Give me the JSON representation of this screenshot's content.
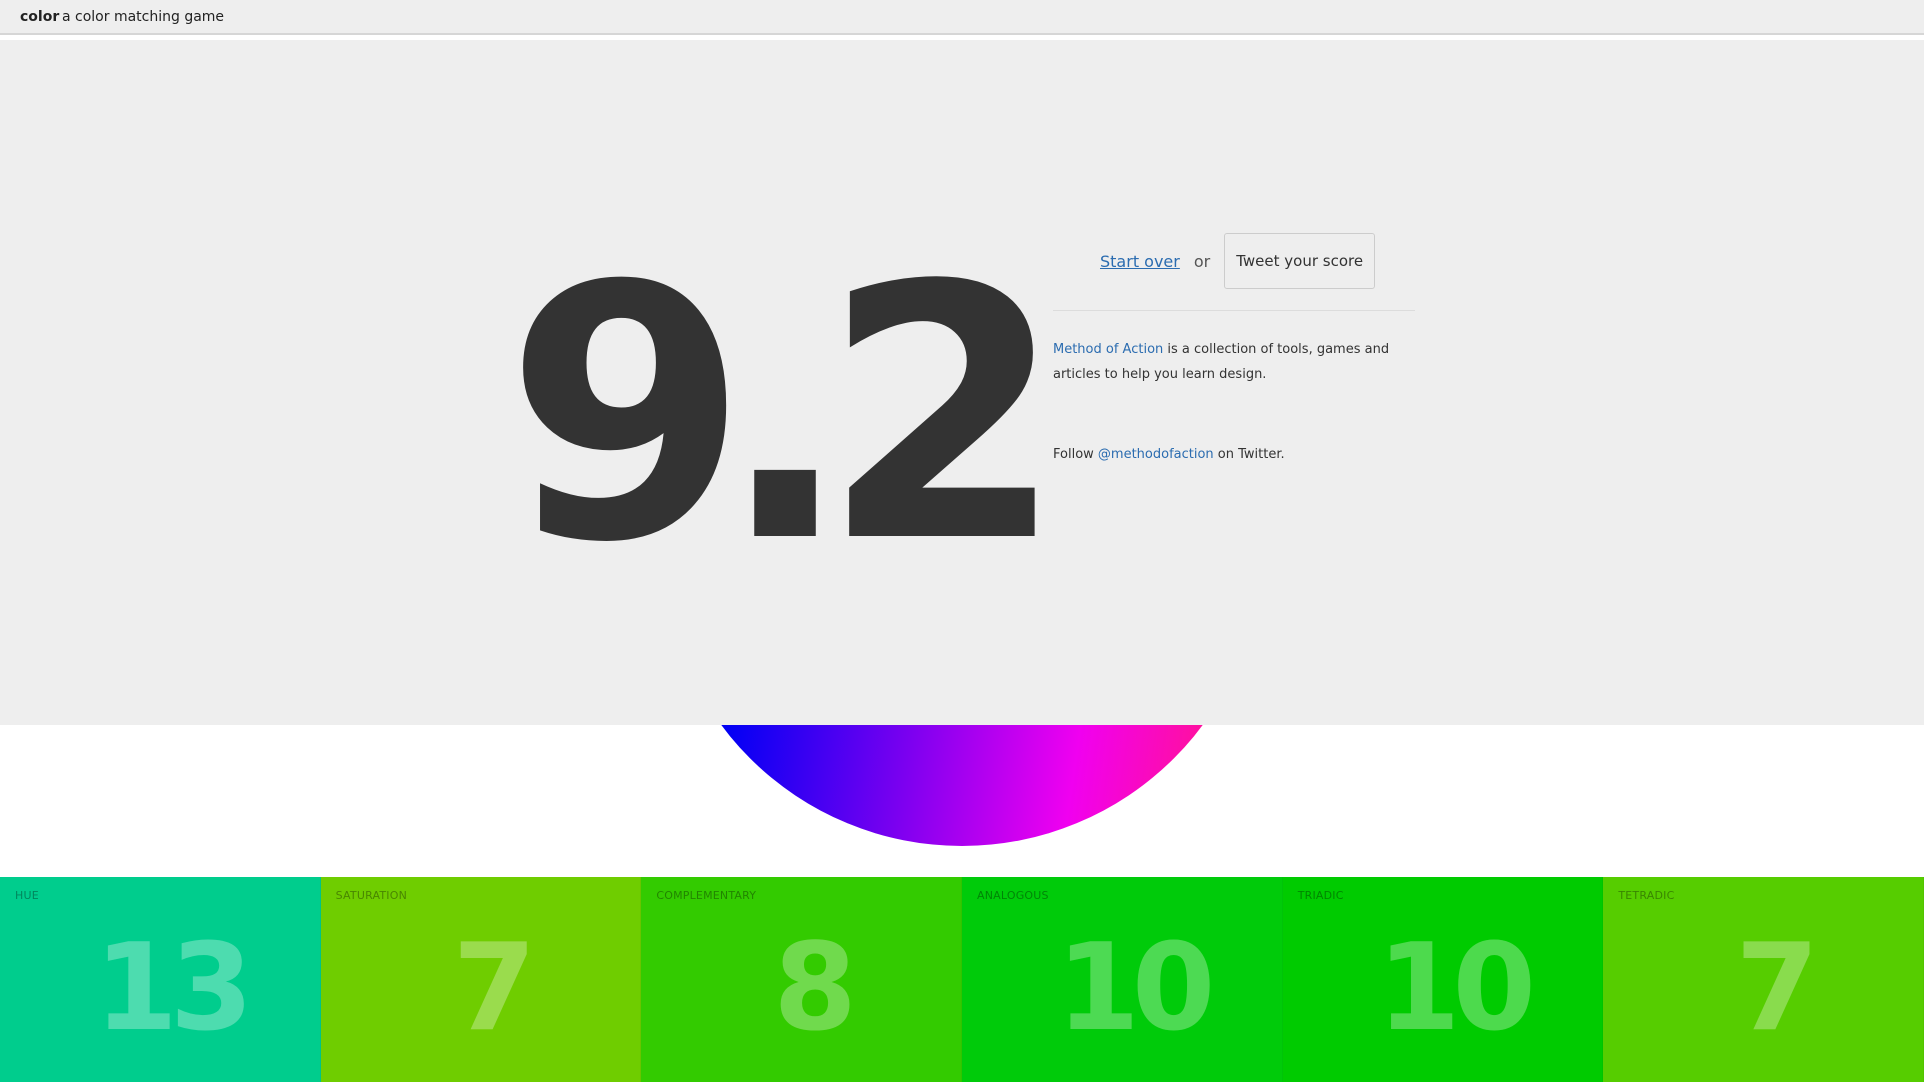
{
  "header": {
    "brand": "color",
    "tagline": "a color matching game"
  },
  "result": {
    "score": "9.2",
    "start_over_label": "Start over",
    "or_label": "or",
    "tweet_label": "Tweet your score"
  },
  "about": {
    "link_text": "Method of Action",
    "text": " is a collection of tools, games and articles to help you learn design.",
    "follow_prefix": "Follow ",
    "twitter_handle": "@methodofaction",
    "follow_suffix": " on Twitter."
  },
  "categories": [
    {
      "label": "HUE",
      "value": "13",
      "color": "#00cd8d"
    },
    {
      "label": "SATURATION",
      "value": "7",
      "color": "#6fcd00"
    },
    {
      "label": "COMPLEMENTARY",
      "value": "8",
      "color": "#33cb00"
    },
    {
      "label": "ANALOGOUS",
      "value": "10",
      "color": "#00cb0a"
    },
    {
      "label": "TRIADIC",
      "value": "10",
      "color": "#00cb00"
    },
    {
      "label": "TETRADIC",
      "value": "7",
      "color": "#56cd00"
    }
  ],
  "colors": {
    "panel_background": "#eeeeee",
    "score_text": "#333333",
    "link": "#2b6cb0"
  }
}
